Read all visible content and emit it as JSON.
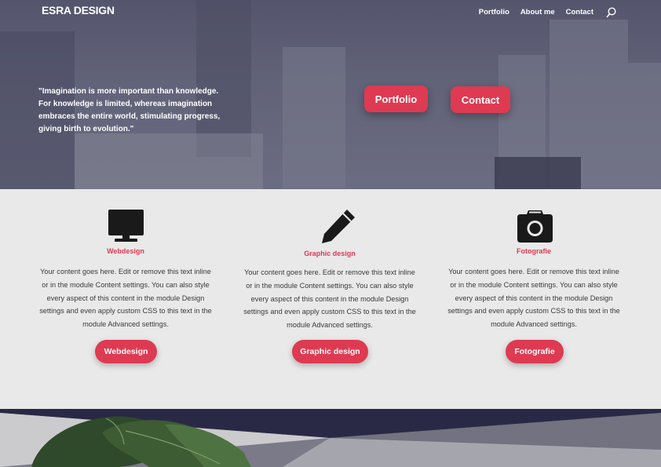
{
  "brand": {
    "logo": "ESRA DESIGN",
    "accent": "#de3a52"
  },
  "nav": {
    "items": [
      {
        "label": "Portfolio"
      },
      {
        "label": "About me"
      },
      {
        "label": "Contact"
      }
    ],
    "search_icon": "search-icon"
  },
  "hero": {
    "quote": "\"Imagination is more important than knowledge. For knowledge is limited, whereas imagination embraces the entire world, stimulating progress, giving birth to evolution.\"",
    "buttons": [
      {
        "label": "Portfolio"
      },
      {
        "label": "Contact"
      }
    ]
  },
  "features": [
    {
      "icon": "monitor-icon",
      "title": "Webdesign",
      "body": "Your content goes here. Edit or remove this text inline or in the module Content settings. You can also style every aspect of this content in the module Design settings and even apply custom CSS to this text in the module Advanced settings.",
      "button": "Webdesign"
    },
    {
      "icon": "pencil-icon",
      "title": "Graphic design",
      "body": "Your content goes here. Edit or remove this text inline or in the module Content settings. You can also style every aspect of this content in the module Design settings and even apply custom CSS to this text in the module Advanced settings.",
      "button": "Graphic design"
    },
    {
      "icon": "camera-icon",
      "title": "Fotografie",
      "body": "Your content goes here. Edit or remove this text inline or in the module Content settings. You can also style every aspect of this content in the module Design settings and even apply custom CSS to this text in the module Advanced settings.",
      "button": "Fotografie"
    }
  ]
}
